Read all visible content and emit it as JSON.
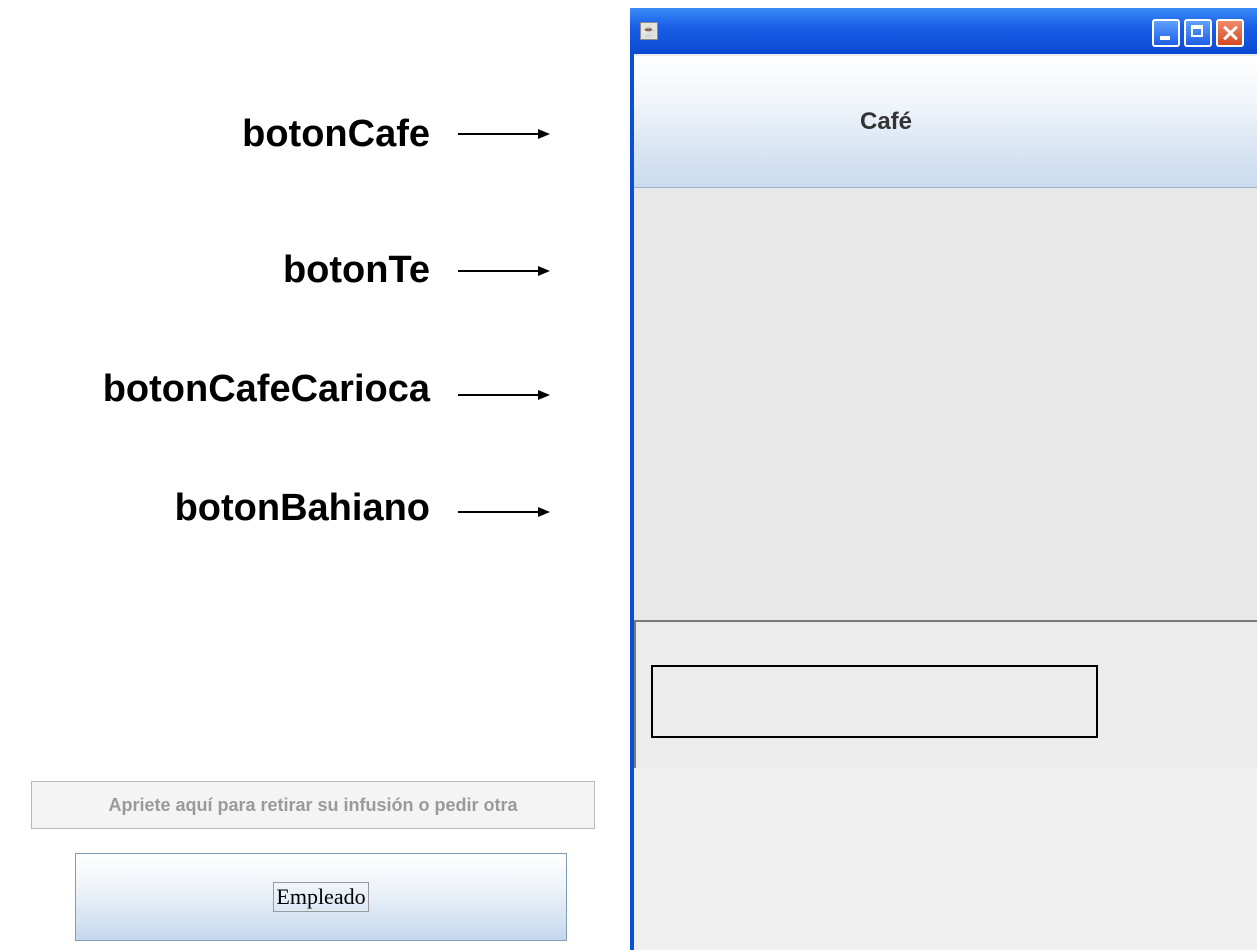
{
  "annotations": [
    {
      "label": "botonCafe"
    },
    {
      "label": "botonTe"
    },
    {
      "label": "botonCafeCarioca"
    },
    {
      "label": "botonBahiano"
    }
  ],
  "window": {
    "title": "",
    "icon": "java-coffee-cup-icon"
  },
  "buttons": {
    "cafe_label": "Café",
    "retirar_label": "Apriete aquí para retirar su infusión o pedir otra",
    "empleado_label": "Empleado"
  },
  "output_field": {
    "value": ""
  },
  "colors": {
    "titlebar": "#0a4fd8",
    "panel_bg": "#ececec",
    "button_gradient_bottom": "#cbdcf0"
  }
}
